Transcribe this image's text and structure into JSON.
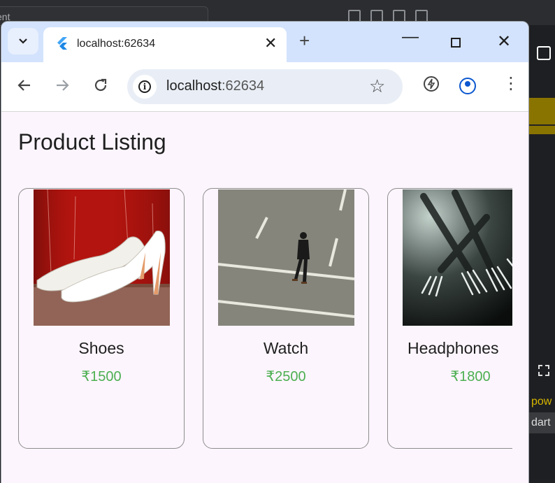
{
  "background_app": {
    "search_text": "ent",
    "side_texts": [
      "pow",
      "dart"
    ]
  },
  "browser": {
    "tab": {
      "title": "localhost:62634",
      "favicon": "flutter-icon"
    },
    "omnibox": {
      "host": "localhost",
      "port": ":62634"
    },
    "icons": [
      "chevron-down-icon",
      "close-icon",
      "plus-icon",
      "minimize-icon",
      "maximize-icon",
      "back-icon",
      "forward-icon",
      "reload-icon",
      "info-icon",
      "star-icon",
      "performance-icon",
      "profile-icon",
      "kebab-menu-icon"
    ]
  },
  "page": {
    "title": "Product Listing",
    "products": [
      {
        "name": "Shoes",
        "price": "₹1500",
        "image": "white high heel shoes on red background"
      },
      {
        "name": "Watch",
        "price": "₹2500",
        "image": "man walking across road"
      },
      {
        "name": "Headphones",
        "price": "₹1800",
        "image": "forks in dark background"
      }
    ],
    "price_color": "#4caf50"
  }
}
